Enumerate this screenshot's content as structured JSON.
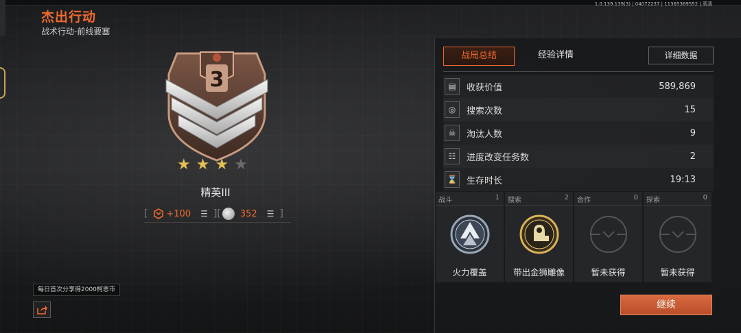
{
  "version": "1.0.139.139(3) | 04072237 | 11365369552 | 高清",
  "header": {
    "title": "杰出行动",
    "subtitle": "战术行动-前线要塞"
  },
  "rank": {
    "level_number": "3",
    "stars_total": 4,
    "stars_earned": 3,
    "name": "精英III",
    "points_gain": "+100",
    "coin_value": "352"
  },
  "tooltip": "每日首次分享得2000柯恩币",
  "panel": {
    "tabs": [
      {
        "label": "战局总结",
        "active": true
      },
      {
        "label": "经验详情",
        "active": false
      }
    ],
    "detail_button": "详细数据",
    "stats": [
      {
        "icon": "money-icon",
        "label": "收获价值",
        "value": "589,869"
      },
      {
        "icon": "search-icon",
        "label": "搜索次数",
        "value": "15"
      },
      {
        "icon": "skull-icon",
        "label": "淘汰人数",
        "value": "9"
      },
      {
        "icon": "checklist-icon",
        "label": "进度改变任务数",
        "value": "2"
      },
      {
        "icon": "hourglass-icon",
        "label": "生存时长",
        "value": "19:13"
      }
    ],
    "awards": [
      {
        "category": "战斗",
        "count": "1",
        "name": "火力覆盖",
        "icon": "arrow-up-badge-icon"
      },
      {
        "category": "搜索",
        "count": "2",
        "name": "带出金狮雕像",
        "icon": "sphinx-badge-icon"
      },
      {
        "category": "合作",
        "count": "0",
        "name": "暂未获得",
        "icon": "locked-badge-icon"
      },
      {
        "category": "探索",
        "count": "0",
        "name": "暂未获得",
        "icon": "locked-badge-icon"
      }
    ]
  },
  "continue_button": "继续",
  "colors": {
    "accent": "#ef6a2d",
    "star": "#e3bf55",
    "continue": "#c85a35"
  }
}
